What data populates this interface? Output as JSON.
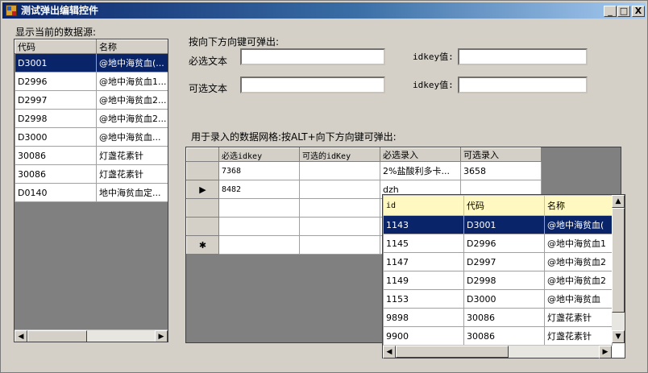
{
  "window": {
    "title": "测试弹出编辑控件",
    "min": "_",
    "max": "□",
    "close": "X"
  },
  "left": {
    "label": "显示当前的数据源:",
    "columns": [
      "代码",
      "名称"
    ],
    "rows": [
      [
        "D3001",
        "@地中海贫血(..."
      ],
      [
        "D2996",
        "@地中海贫血1..."
      ],
      [
        "D2997",
        "@地中海贫血2..."
      ],
      [
        "D2998",
        "@地中海贫血2..."
      ],
      [
        "D3000",
        "@地中海贫血..."
      ],
      [
        "30086",
        "灯盏花素针"
      ],
      [
        "30086",
        "灯盏花素针"
      ],
      [
        "D0140",
        "地中海贫血定..."
      ]
    ]
  },
  "form": {
    "hint": "按向下方向键可弹出:",
    "required_label": "必选文本",
    "optional_label": "可选文本",
    "idkey_label1": "idkey值:",
    "idkey_label2": "idkey值:",
    "required_value": "",
    "optional_value": "",
    "idkey_value1": "",
    "idkey_value2": ""
  },
  "entry": {
    "label": "用于录入的数据网格:按ALT+向下方向键可弹出:",
    "columns": [
      "必选idkey",
      "可选的idKey",
      "必选录入",
      "可选录入"
    ],
    "rows": [
      [
        "7368",
        "",
        "2%盐酸利多卡...",
        "3658"
      ],
      [
        "8482",
        "",
        "dzh",
        ""
      ],
      [
        "",
        "",
        "",
        ""
      ],
      [
        "",
        "",
        "",
        ""
      ],
      [
        "",
        "",
        "",
        ""
      ]
    ],
    "row_markers": [
      "",
      "▶",
      "",
      "",
      "✱"
    ]
  },
  "popup": {
    "columns": [
      "id",
      "代码",
      "名称"
    ],
    "rows": [
      [
        "1143",
        "D3001",
        "@地中海贫血("
      ],
      [
        "1145",
        "D2996",
        "@地中海贫血1"
      ],
      [
        "1147",
        "D2997",
        "@地中海贫血2"
      ],
      [
        "1149",
        "D2998",
        "@地中海贫血2"
      ],
      [
        "1153",
        "D3000",
        "@地中海贫血"
      ],
      [
        "9898",
        "30086",
        "灯盏花素针"
      ],
      [
        "9900",
        "30086",
        "灯盏花素针"
      ]
    ]
  },
  "scroll": {
    "left": "◀",
    "right": "▶",
    "up": "▲",
    "down": "▼"
  }
}
